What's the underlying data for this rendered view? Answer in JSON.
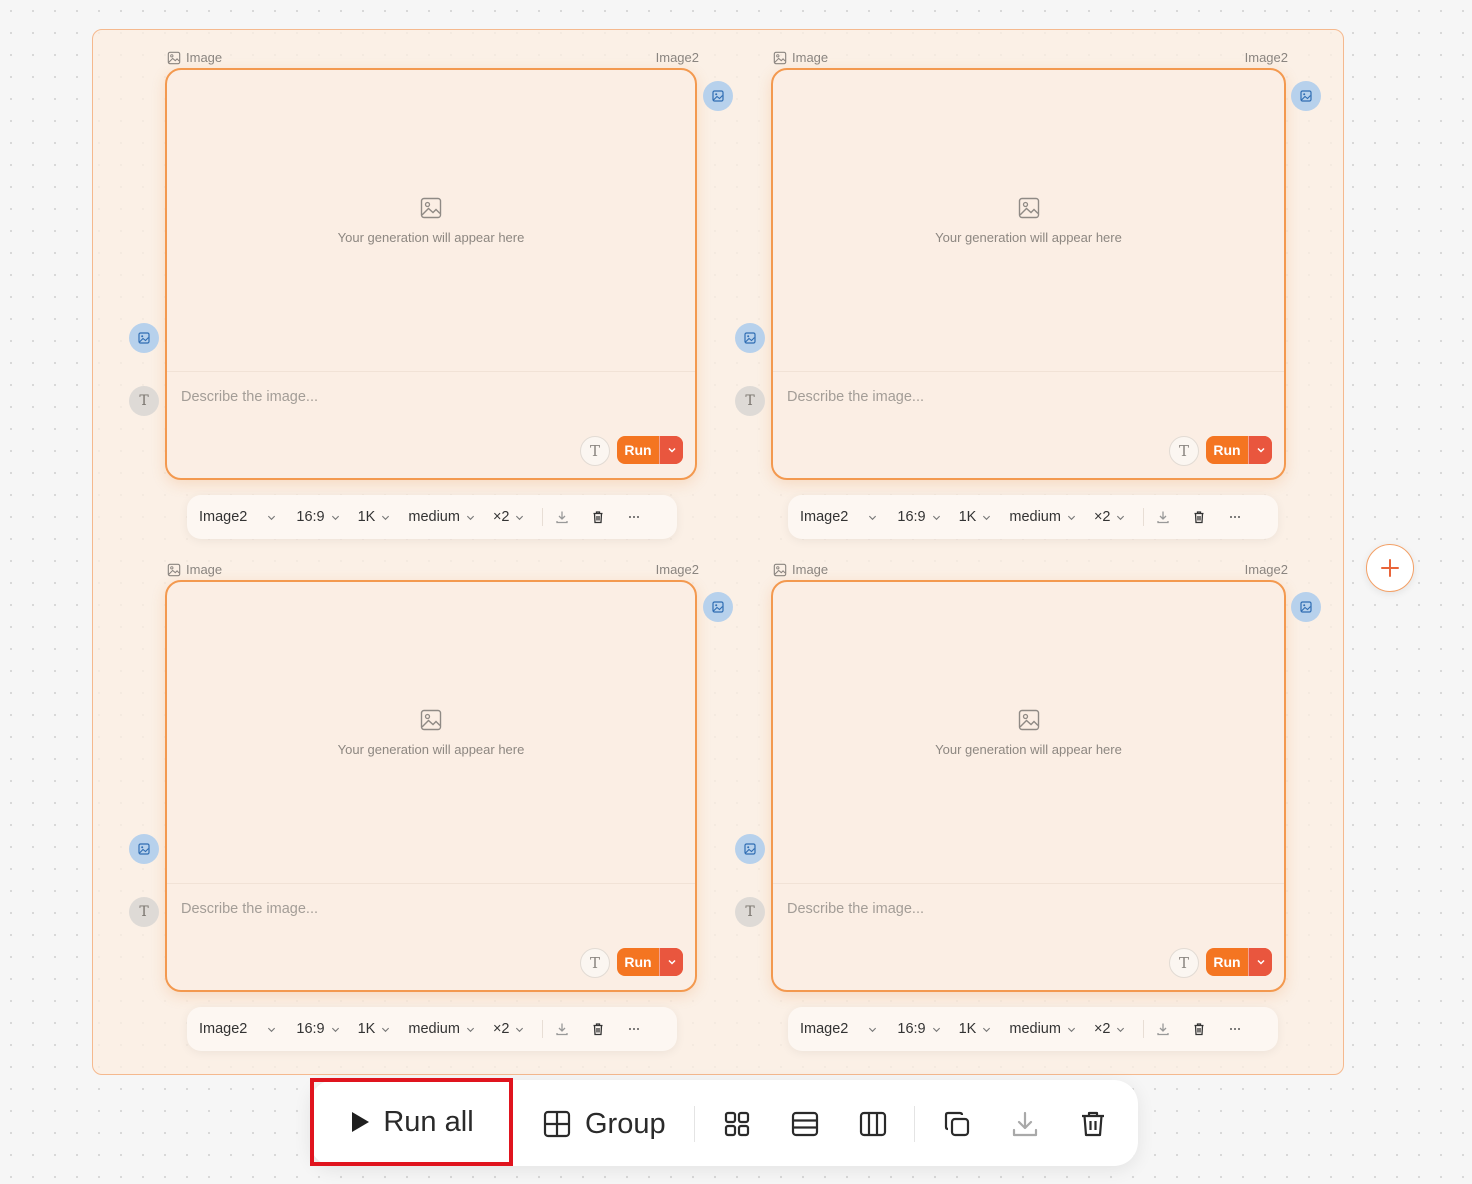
{
  "nodes": [
    {
      "type_label": "Image",
      "model_tag": "Image2",
      "placeholder_text": "Your generation will appear here",
      "prompt_placeholder": "Describe the image...",
      "run_label": "Run",
      "settings": {
        "model": "Image2",
        "aspect": "16:9",
        "resolution": "1K",
        "quality": "medium",
        "count": "×2"
      }
    },
    {
      "type_label": "Image",
      "model_tag": "Image2",
      "placeholder_text": "Your generation will appear here",
      "prompt_placeholder": "Describe the image...",
      "run_label": "Run",
      "settings": {
        "model": "Image2",
        "aspect": "16:9",
        "resolution": "1K",
        "quality": "medium",
        "count": "×2"
      }
    },
    {
      "type_label": "Image",
      "model_tag": "Image2",
      "placeholder_text": "Your generation will appear here",
      "prompt_placeholder": "Describe the image...",
      "run_label": "Run",
      "settings": {
        "model": "Image2",
        "aspect": "16:9",
        "resolution": "1K",
        "quality": "medium",
        "count": "×2"
      }
    },
    {
      "type_label": "Image",
      "model_tag": "Image2",
      "placeholder_text": "Your generation will appear here",
      "prompt_placeholder": "Describe the image...",
      "run_label": "Run",
      "settings": {
        "model": "Image2",
        "aspect": "16:9",
        "resolution": "1K",
        "quality": "medium",
        "count": "×2"
      }
    }
  ],
  "port_text_glyph": "T",
  "toolbar": {
    "run_all_label": "Run all",
    "group_label": "Group",
    "icons": [
      "grid-layout-icon",
      "rows-layout-icon",
      "columns-layout-icon",
      "duplicate-icon",
      "download-icon",
      "trash-icon"
    ]
  },
  "colors": {
    "accent": "#f47521",
    "run_dropdown": "#e9563e",
    "card_border": "#f3994f",
    "image_port": "#b7d1ec",
    "highlight": "#e0141e"
  }
}
